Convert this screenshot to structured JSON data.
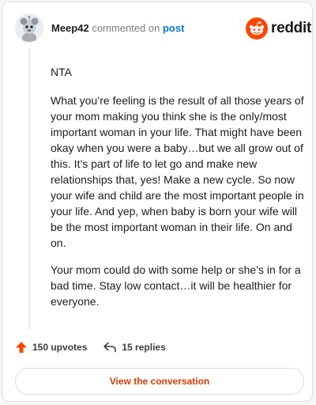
{
  "header": {
    "username": "Meep42",
    "action_text": "commented on",
    "post_link": "post",
    "brand": "reddit"
  },
  "comment": {
    "paragraphs": [
      "NTA",
      "What you’re feeling is the result of all those years of your mom making you think she is the only/most important woman in your life. That might have been okay when you were a baby…but we all grow out of this. It’s part of life to let go and make new relationships that, yes! Make a new cycle. So now your wife and child are the most important people in your life. And yep, when baby is born your wife will be the most important woman in their life. On and on.",
      "Your mom could do with some help or she’s in for a bad time. Stay low contact…it will be healthier for everyone."
    ]
  },
  "stats": {
    "upvotes": "150 upvotes",
    "replies": "15 replies"
  },
  "cta": {
    "label": "View the conversation"
  },
  "colors": {
    "brand_orange": "#ff4500",
    "link_blue": "#0079d3",
    "cta_text": "#d93a00"
  }
}
